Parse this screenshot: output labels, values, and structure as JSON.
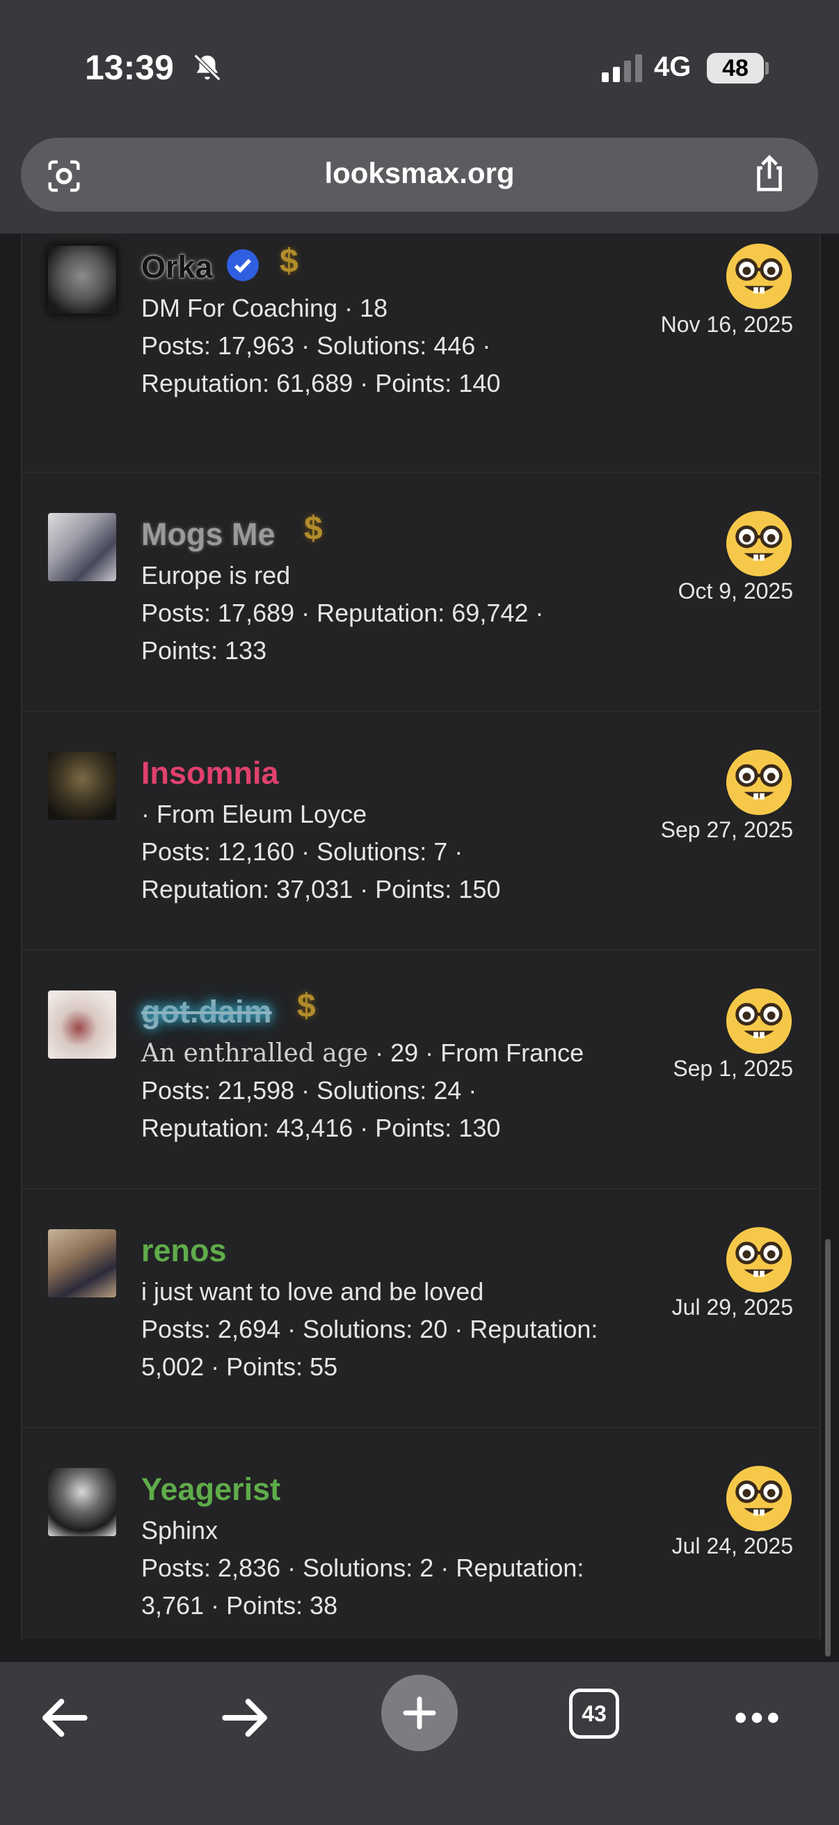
{
  "status": {
    "time": "13:39",
    "network": "4G",
    "battery": "48"
  },
  "browser": {
    "url": "looksmax.org",
    "tab_count": "43"
  },
  "members": [
    {
      "name": "Orka",
      "name_color": "#1b1b1b",
      "verified": true,
      "dollar": true,
      "title": "DM For Coaching",
      "title_extra": " · 18",
      "stats1": "Posts: 17,963 · Solutions: 446 ·",
      "stats2": "Reputation: 61,689 · Points: 140",
      "date": "Nov 16, 2025"
    },
    {
      "name": "Mogs Me",
      "name_color": "#9a9a9a",
      "verified": false,
      "dollar": true,
      "title": "Europe is red",
      "title_extra": "",
      "stats1": "Posts: 17,689 · Reputation: 69,742 ·",
      "stats2": "Points: 133",
      "date": "Oct 9, 2025"
    },
    {
      "name": "Insomnia",
      "name_color": "#e0416e",
      "verified": false,
      "dollar": false,
      "title": " · From Eleum Loyce",
      "title_extra": "",
      "stats1": "Posts: 12,160 · Solutions: 7 ·",
      "stats2": "Reputation: 37,031 · Points: 150",
      "date": "Sep 27, 2025"
    },
    {
      "name": "got.daim",
      "name_color": "#8fb2be",
      "verified": false,
      "dollar": true,
      "title": "An enthralled age",
      "title_extra": " · 29 · From France",
      "stats1": "Posts: 21,598 · Solutions: 24 ·",
      "stats2": "Reputation: 43,416 · Points: 130",
      "date": "Sep 1, 2025"
    },
    {
      "name": "renos",
      "name_color": "#5fac4a",
      "verified": false,
      "dollar": false,
      "title": "i just want to love and be loved",
      "title_extra": "",
      "stats1": "Posts: 2,694 · Solutions: 20 · Reputation:",
      "stats2": "5,002 · Points: 55",
      "date": "Jul 29, 2025"
    },
    {
      "name": "Yeagerist",
      "name_color": "#5fac4a",
      "verified": false,
      "dollar": false,
      "title": "Sphinx",
      "title_extra": "",
      "stats1": "Posts: 2,836 · Solutions: 2 · Reputation:",
      "stats2": "3,761 · Points: 38",
      "date": "Jul 24, 2025"
    }
  ]
}
